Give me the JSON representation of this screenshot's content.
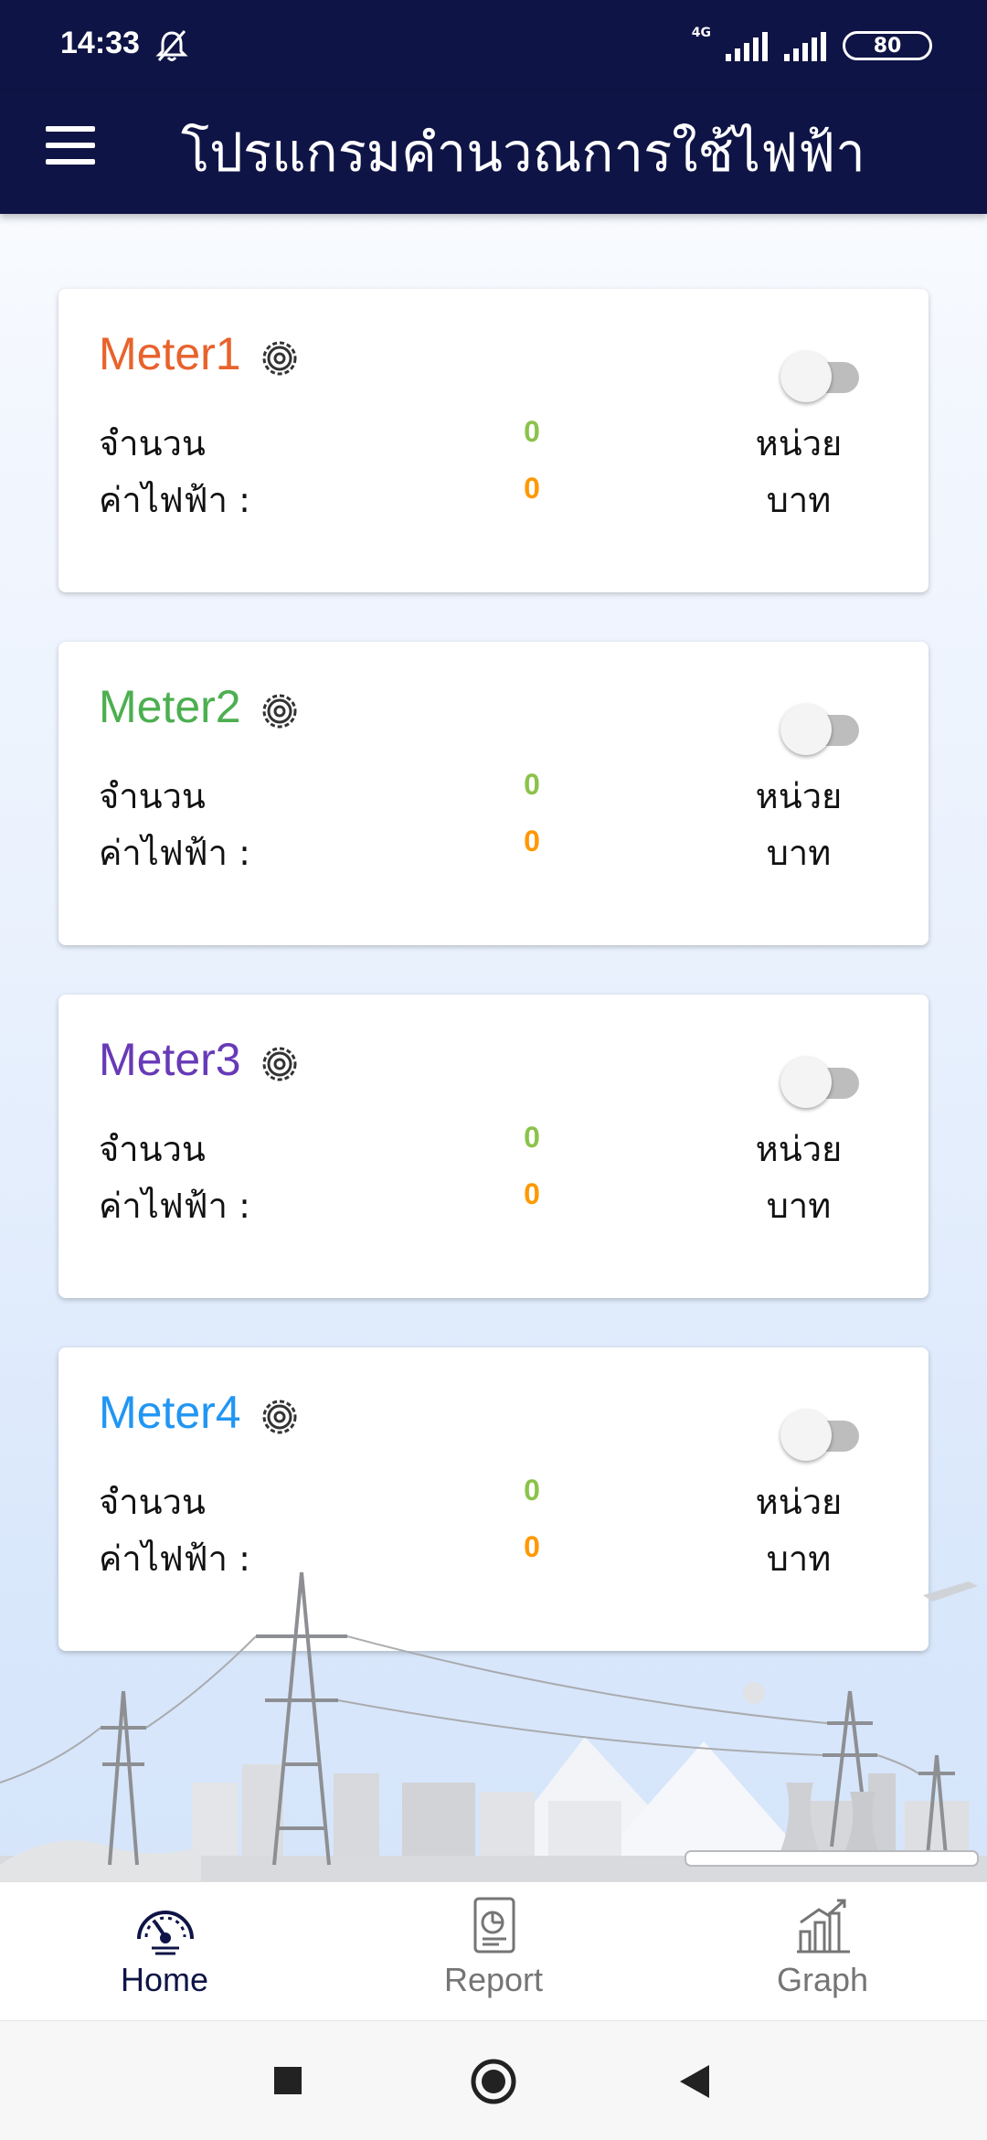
{
  "status": {
    "time": "14:33",
    "network": "4G",
    "battery": "80"
  },
  "appbar": {
    "title": "โปรแกรมคำนวณการใช้ไฟฟ้า"
  },
  "meters": [
    {
      "name": "Meter1",
      "color": "#e8622c",
      "units_label": "จำนวน",
      "units_value": "0",
      "units_suffix": "หน่วย",
      "cost_label": "ค่าไฟฟ้า :",
      "cost_value": "0",
      "cost_suffix": "บาท",
      "enabled": false
    },
    {
      "name": "Meter2",
      "color": "#4caf50",
      "units_label": "จำนวน",
      "units_value": "0",
      "units_suffix": "หน่วย",
      "cost_label": "ค่าไฟฟ้า :",
      "cost_value": "0",
      "cost_suffix": "บาท",
      "enabled": false
    },
    {
      "name": "Meter3",
      "color": "#673ab7",
      "units_label": "จำนวน",
      "units_value": "0",
      "units_suffix": "หน่วย",
      "cost_label": "ค่าไฟฟ้า :",
      "cost_value": "0",
      "cost_suffix": "บาท",
      "enabled": false
    },
    {
      "name": "Meter4",
      "color": "#2196f3",
      "units_label": "จำนวน",
      "units_value": "0",
      "units_suffix": "หน่วย",
      "cost_label": "ค่าไฟฟ้า :",
      "cost_value": "0",
      "cost_suffix": "บาท",
      "enabled": false
    }
  ],
  "colors": {
    "header_bg": "#0f1446",
    "units_value": "#8bc34a",
    "cost_value": "#ff9800",
    "nav_active": "#0f1446",
    "nav_inactive": "#757575"
  },
  "bottom_nav": [
    {
      "label": "Home",
      "icon": "speedometer-icon",
      "active": true
    },
    {
      "label": "Report",
      "icon": "report-icon",
      "active": false
    },
    {
      "label": "Graph",
      "icon": "bar-chart-icon",
      "active": false
    }
  ]
}
